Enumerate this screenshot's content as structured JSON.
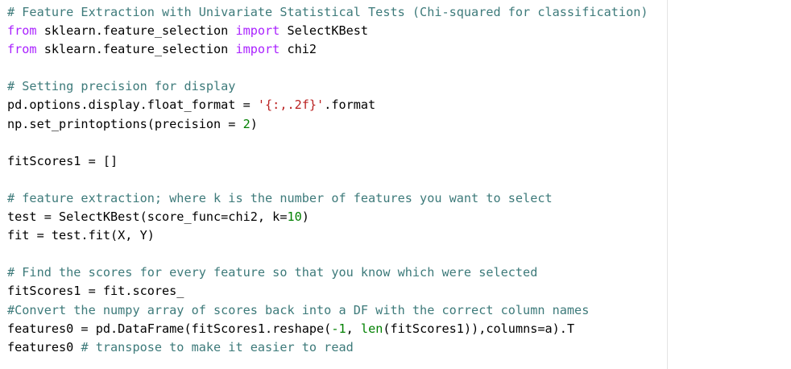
{
  "colors": {
    "comment": "#3d7a7a",
    "keyword": "#aa22ff",
    "builtin": "#008000",
    "number": "#008000",
    "string": "#ba2121",
    "text": "#000000",
    "background": "#ffffff",
    "margin_guide": "#e4e4e4"
  },
  "code_lines": [
    [
      {
        "t": "comment",
        "v": "# Feature Extraction with Univariate Statistical Tests (Chi-squared for classification)"
      }
    ],
    [
      {
        "t": "keyword",
        "v": "from"
      },
      {
        "t": "text",
        "v": " sklearn.feature_selection "
      },
      {
        "t": "keyword",
        "v": "import"
      },
      {
        "t": "text",
        "v": " SelectKBest"
      }
    ],
    [
      {
        "t": "keyword",
        "v": "from"
      },
      {
        "t": "text",
        "v": " sklearn.feature_selection "
      },
      {
        "t": "keyword",
        "v": "import"
      },
      {
        "t": "text",
        "v": " chi2"
      }
    ],
    [],
    [
      {
        "t": "comment",
        "v": "# Setting precision for display"
      }
    ],
    [
      {
        "t": "text",
        "v": "pd.options.display.float_format = "
      },
      {
        "t": "string",
        "v": "'{:,.2f}'"
      },
      {
        "t": "text",
        "v": ".format"
      }
    ],
    [
      {
        "t": "text",
        "v": "np.set_printoptions(precision = "
      },
      {
        "t": "number",
        "v": "2"
      },
      {
        "t": "text",
        "v": ")"
      }
    ],
    [],
    [
      {
        "t": "text",
        "v": "fitScores1 = []"
      }
    ],
    [],
    [
      {
        "t": "comment",
        "v": "# feature extraction; where k is the number of features you want to select"
      }
    ],
    [
      {
        "t": "text",
        "v": "test = SelectKBest(score_func=chi2, k="
      },
      {
        "t": "number",
        "v": "10"
      },
      {
        "t": "text",
        "v": ")"
      }
    ],
    [
      {
        "t": "text",
        "v": "fit = test.fit(X, Y)"
      }
    ],
    [],
    [
      {
        "t": "comment",
        "v": "# Find the scores for every feature so that you know which were selected"
      }
    ],
    [
      {
        "t": "text",
        "v": "fitScores1 = fit.scores_"
      }
    ],
    [
      {
        "t": "comment",
        "v": "#Convert the numpy array of scores back into a DF with the correct column names"
      }
    ],
    [
      {
        "t": "text",
        "v": "features0 = pd.DataFrame(fitScores1.reshape("
      },
      {
        "t": "number",
        "v": "-1"
      },
      {
        "t": "text",
        "v": ", "
      },
      {
        "t": "builtin",
        "v": "len"
      },
      {
        "t": "text",
        "v": "(fitScores1)),columns=a).T"
      }
    ],
    [
      {
        "t": "text",
        "v": "features0 "
      },
      {
        "t": "comment",
        "v": "# transpose to make it easier to read"
      }
    ]
  ]
}
